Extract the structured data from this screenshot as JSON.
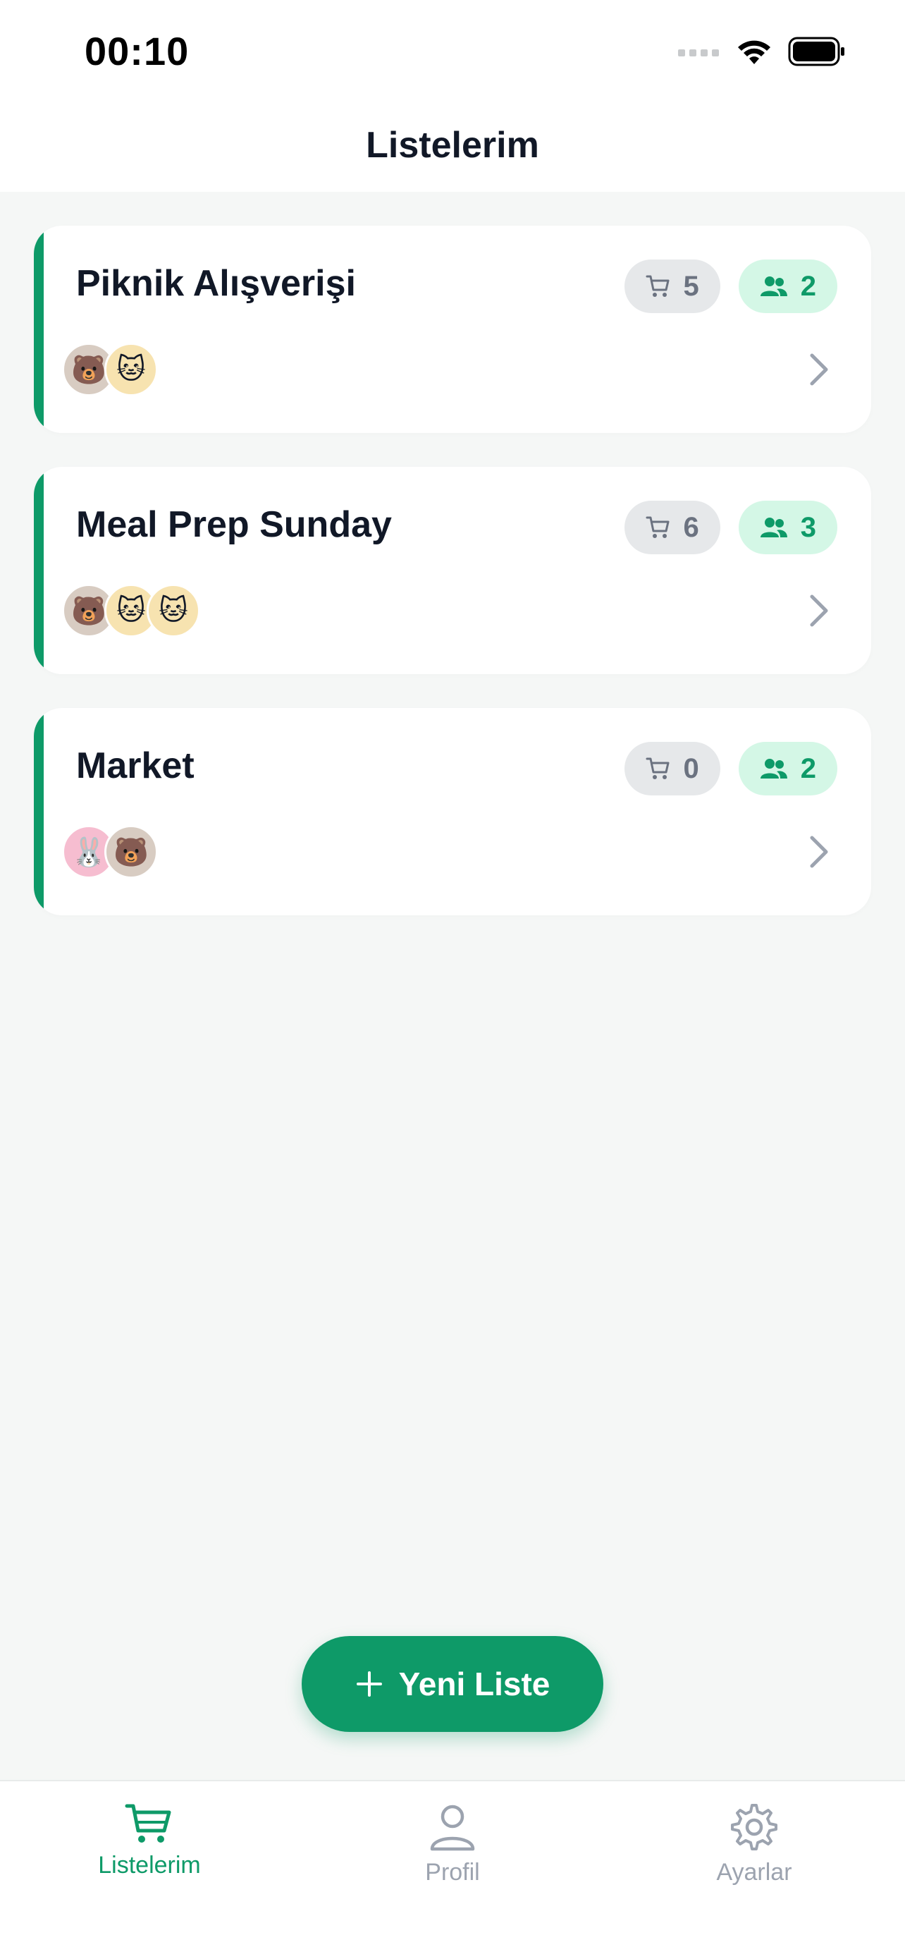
{
  "status_bar": {
    "time": "00:10"
  },
  "header": {
    "title": "Listelerim"
  },
  "lists": [
    {
      "title": "Piknik Alışverişi",
      "items_count": "5",
      "members_count": "2",
      "avatars": [
        "🐻",
        "🐱"
      ]
    },
    {
      "title": "Meal Prep Sunday",
      "items_count": "6",
      "members_count": "3",
      "avatars": [
        "🐻",
        "🐱",
        "🐱"
      ]
    },
    {
      "title": "Market",
      "items_count": "0",
      "members_count": "2",
      "avatars": [
        "🐰",
        "🐻"
      ]
    }
  ],
  "fab": {
    "label": "Yeni Liste"
  },
  "tabbar": {
    "tabs": [
      {
        "label": "Listelerim",
        "icon": "cart-icon",
        "active": true
      },
      {
        "label": "Profil",
        "icon": "person-icon",
        "active": false
      },
      {
        "label": "Ayarlar",
        "icon": "gear-icon",
        "active": false
      }
    ]
  },
  "colors": {
    "accent": "#0E9A68",
    "background": "#F5F7F6",
    "members_badge_bg": "#D4F7E6",
    "items_badge_bg": "#E6E8EA"
  }
}
